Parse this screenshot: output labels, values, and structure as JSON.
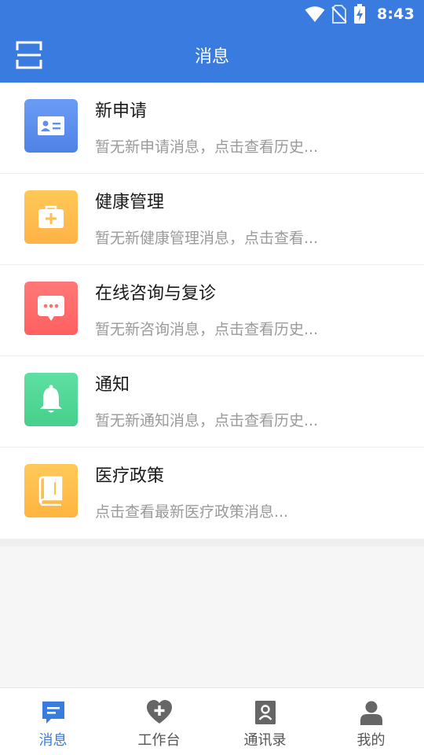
{
  "status_bar": {
    "time": "8:43",
    "icons": [
      "wifi-icon",
      "no-sim-icon",
      "battery-charging-icon"
    ]
  },
  "header": {
    "title": "消息",
    "left_icon": "scan-icon"
  },
  "messages": [
    {
      "title": "新申请",
      "desc": "暂无新申请消息，点击查看历史...",
      "icon": "id-card-icon",
      "color": "#5f8ff0"
    },
    {
      "title": "健康管理",
      "desc": "暂无新健康管理消息，点击查看...",
      "icon": "medical-kit-icon",
      "color": "#ffbe4f"
    },
    {
      "title": "在线咨询与复诊",
      "desc": "暂无新咨询消息，点击查看历史...",
      "icon": "chat-bubble-icon",
      "color": "#ff6f6f"
    },
    {
      "title": "通知",
      "desc": "暂无新通知消息，点击查看历史...",
      "icon": "bell-icon",
      "color": "#52d698"
    },
    {
      "title": "医疗政策",
      "desc": "点击查看最新医疗政策消息...",
      "icon": "book-icon",
      "color": "#ffc052"
    }
  ],
  "tabs": [
    {
      "label": "消息",
      "icon": "message-icon",
      "active": true
    },
    {
      "label": "工作台",
      "icon": "heart-plus-icon",
      "active": false
    },
    {
      "label": "通讯录",
      "icon": "contacts-icon",
      "active": false
    },
    {
      "label": "我的",
      "icon": "user-icon",
      "active": false
    }
  ],
  "colors": {
    "primary": "#3a7be0",
    "tab_inactive_icon": "#666666"
  }
}
